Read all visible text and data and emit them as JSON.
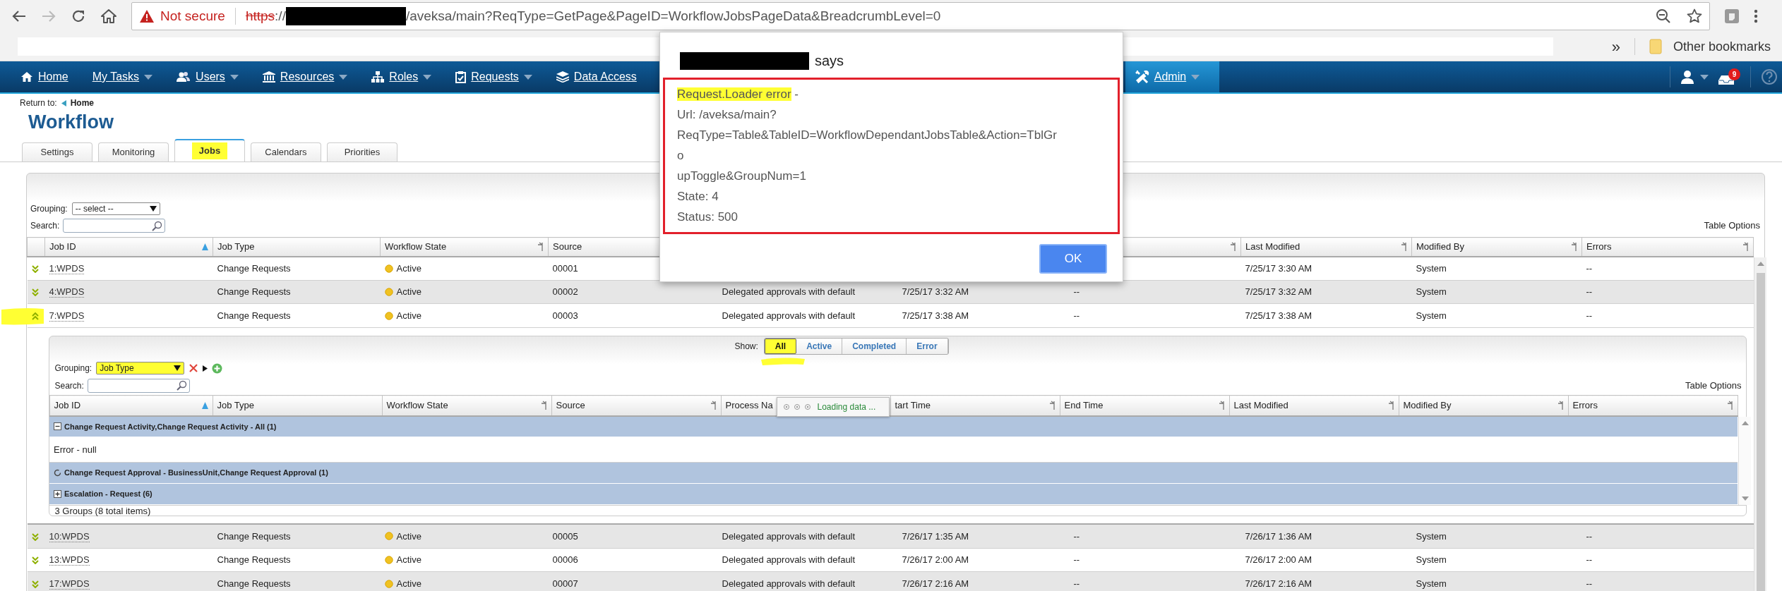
{
  "browser": {
    "security_warning": "Not secure",
    "url_scheme": "https",
    "url_separator": "://",
    "url_path": "/aveksa/main?ReqType=GetPage&PageID=WorkflowJobsPageData&BreadcrumbLevel=0",
    "bookmarks_overflow": "»",
    "other_bookmarks": "Other bookmarks"
  },
  "navbar": {
    "items": [
      {
        "label": "Home",
        "dropdown": false,
        "selected": false
      },
      {
        "label": "My Tasks",
        "dropdown": true,
        "selected": false
      },
      {
        "label": "Users",
        "dropdown": true,
        "selected": false
      },
      {
        "label": "Resources",
        "dropdown": true,
        "selected": false
      },
      {
        "label": "Roles",
        "dropdown": true,
        "selected": false
      },
      {
        "label": "Requests",
        "dropdown": true,
        "selected": false
      },
      {
        "label": "Data Access",
        "dropdown": false,
        "selected": false
      },
      {
        "label": "Admin",
        "dropdown": true,
        "selected": true
      }
    ],
    "notification_count": "9"
  },
  "breadcrumb": {
    "label": "Return to:",
    "link": "Home"
  },
  "page_title": "Workflow",
  "tabs": [
    {
      "label": "Settings",
      "selected": false,
      "highlighted": false
    },
    {
      "label": "Monitoring",
      "selected": false,
      "highlighted": false
    },
    {
      "label": "Jobs",
      "selected": true,
      "highlighted": true
    },
    {
      "label": "Calendars",
      "selected": false,
      "highlighted": false
    },
    {
      "label": "Priorities",
      "selected": false,
      "highlighted": false
    }
  ],
  "jobs_table": {
    "grouping_label": "Grouping:",
    "grouping_value": "-- select --",
    "search_label": "Search:",
    "table_options": "Table Options",
    "columns": [
      {
        "label": "Job ID",
        "kind": "link"
      },
      {
        "label": "Job Type",
        "kind": "text"
      },
      {
        "label": "Workflow State",
        "kind": "status"
      },
      {
        "label": "Source",
        "kind": "text"
      },
      {
        "kind": "text"
      },
      {
        "kind": "text"
      },
      {
        "kind": "text"
      },
      {
        "label": "Last Modified",
        "kind": "text"
      },
      {
        "label": "Modified By",
        "kind": "text"
      },
      {
        "label": "Errors",
        "kind": "text"
      }
    ],
    "rows": [
      {
        "expanded": false,
        "marked": false,
        "cells": [
          "1:WPDS",
          "Change Requests",
          "Active",
          "00001",
          null,
          null,
          null,
          "7/25/17 3:30 AM",
          "System",
          "--"
        ]
      },
      {
        "expanded": false,
        "marked": false,
        "cells": [
          "4:WPDS",
          "Change Requests",
          "Active",
          "00002",
          "Delegated approvals with default",
          "7/25/17 3:32 AM",
          "--",
          "7/25/17 3:32 AM",
          "System",
          "--"
        ]
      },
      {
        "expanded": true,
        "marked": true,
        "cells": [
          "7:WPDS",
          "Change Requests",
          "Active",
          "00003",
          "Delegated approvals with default",
          "7/25/17 3:38 AM",
          "--",
          "7/25/17 3:38 AM",
          "System",
          "--"
        ],
        "detail": {
          "show_label": "Show:",
          "show_filters": [
            {
              "label": "All",
              "selected": true,
              "highlighted": true
            },
            {
              "label": "Active",
              "selected": false,
              "highlighted": false
            },
            {
              "label": "Completed",
              "selected": false,
              "highlighted": false
            },
            {
              "label": "Error",
              "selected": false,
              "highlighted": false
            }
          ],
          "grouping_label": "Grouping:",
          "grouping_value": "Job Type",
          "grouping_highlighted": true,
          "search_label": "Search:",
          "table_options": "Table Options",
          "columns": [
            {
              "label": "Job ID"
            },
            {
              "label": "Job Type"
            },
            {
              "label": "Workflow State"
            },
            {
              "label": "Source"
            },
            {
              "label": "Process Na"
            },
            {
              "label": "tart Time"
            },
            {
              "label": "End Time"
            },
            {
              "label": "Last Modified"
            },
            {
              "label": "Modified By"
            },
            {
              "label": "Errors"
            }
          ],
          "loading_text": "Loading data ...",
          "groups": [
            {
              "label": "Change Request Activity,Change Request Activity - All (1)",
              "expanded": true,
              "loading": false,
              "items": [
                "Error - null"
              ]
            },
            {
              "label": "Change Request Approval - BusinessUnit,Change Request Approval (1)",
              "expanded": false,
              "loading": true
            },
            {
              "label": "Escalation - Request (6)",
              "expanded": false,
              "loading": false
            }
          ],
          "footer": "3 Groups (8 total items)"
        }
      },
      {
        "expanded": false,
        "marked": false,
        "cells": [
          "10:WPDS",
          "Change Requests",
          "Active",
          "00005",
          "Delegated approvals with default",
          "7/26/17 1:35 AM",
          "--",
          "7/26/17 1:36 AM",
          "System",
          "--"
        ]
      },
      {
        "expanded": false,
        "marked": false,
        "cells": [
          "13:WPDS",
          "Change Requests",
          "Active",
          "00006",
          "Delegated approvals with default",
          "7/26/17 2:00 AM",
          "--",
          "7/26/17 2:00 AM",
          "System",
          "--"
        ]
      },
      {
        "expanded": false,
        "marked": false,
        "cells": [
          "17:WPDS",
          "Change Requests",
          "Active",
          "00007",
          "Delegated approvals with default",
          "7/26/17 2:16 AM",
          "--",
          "7/26/17 2:16 AM",
          "System",
          "--"
        ]
      }
    ]
  },
  "dialog": {
    "title_suffix": "says",
    "lines": [
      {
        "highlight": "Request.Loader error",
        "text": " -"
      },
      {
        "text": "Url: /aveksa/main?"
      },
      {
        "text": "ReqType=Table&TableID=WorkflowDependantJobsTable&Action=TblGr"
      },
      {
        "text": "o"
      },
      {
        "text": "upToggle&GroupNum=1"
      },
      {
        "text": "State: 4"
      },
      {
        "text": "Status: 500"
      }
    ],
    "button": "OK"
  }
}
